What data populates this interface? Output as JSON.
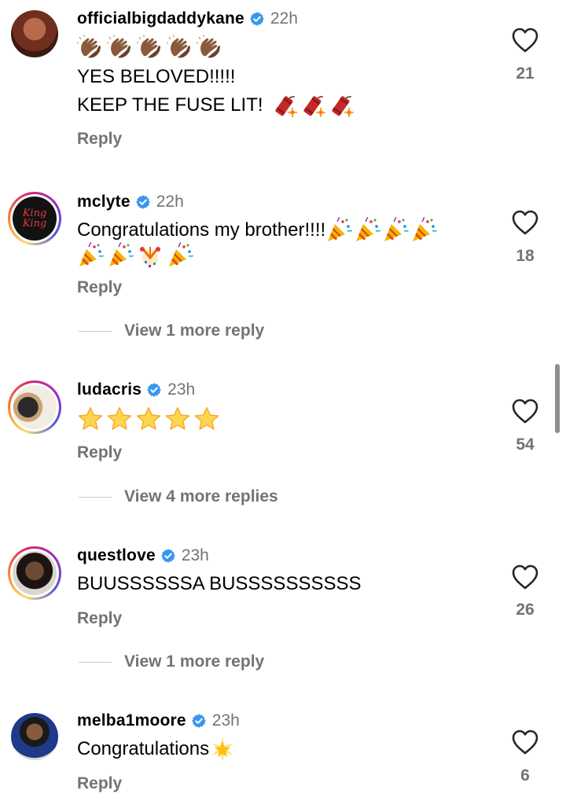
{
  "comments": [
    {
      "username": "officialbigdaddykane",
      "time": "22h",
      "line1_emoji": [
        "clap-brown-icon",
        "clap-brown-icon",
        "clap-brown-icon",
        "clap-brown-icon",
        "clap-brown-icon"
      ],
      "line2": "YES BELOVED!!!!!",
      "line3": "KEEP THE FUSE LIT!",
      "line3_emoji": [
        "firecracker-icon",
        "firecracker-icon",
        "firecracker-icon"
      ],
      "likes": "21",
      "reply": "Reply"
    },
    {
      "username": "mclyte",
      "time": "22h",
      "avatar_text": "King\nKing",
      "line1": "Congratulations my brother!!!!",
      "line1_emoji": [
        "party-popper-icon",
        "party-popper-icon",
        "party-popper-icon",
        "party-popper-icon"
      ],
      "line2_emoji": [
        "party-popper-icon",
        "party-popper-icon",
        "confetti-ball-icon",
        "party-popper-icon"
      ],
      "likes": "18",
      "reply": "Reply",
      "view_more": "View 1 more reply"
    },
    {
      "username": "ludacris",
      "time": "23h",
      "line1_emoji": [
        "star-icon",
        "star-icon",
        "star-icon",
        "star-icon",
        "star-icon"
      ],
      "likes": "54",
      "reply": "Reply",
      "view_more": "View 4 more replies"
    },
    {
      "username": "questlove",
      "time": "23h",
      "line1": "BUUSSSSSSA BUSSSSSSSSSS",
      "likes": "26",
      "reply": "Reply",
      "view_more": "View 1 more reply"
    },
    {
      "username": "melba1moore",
      "time": "23h",
      "line1": "Congratulations",
      "line1_emoji": [
        "glowing-star-icon"
      ],
      "likes": "6",
      "reply": "Reply"
    }
  ],
  "colors": {
    "verified": "#3897f0",
    "muted_text": "#737373",
    "heart_stroke": "#262626"
  }
}
